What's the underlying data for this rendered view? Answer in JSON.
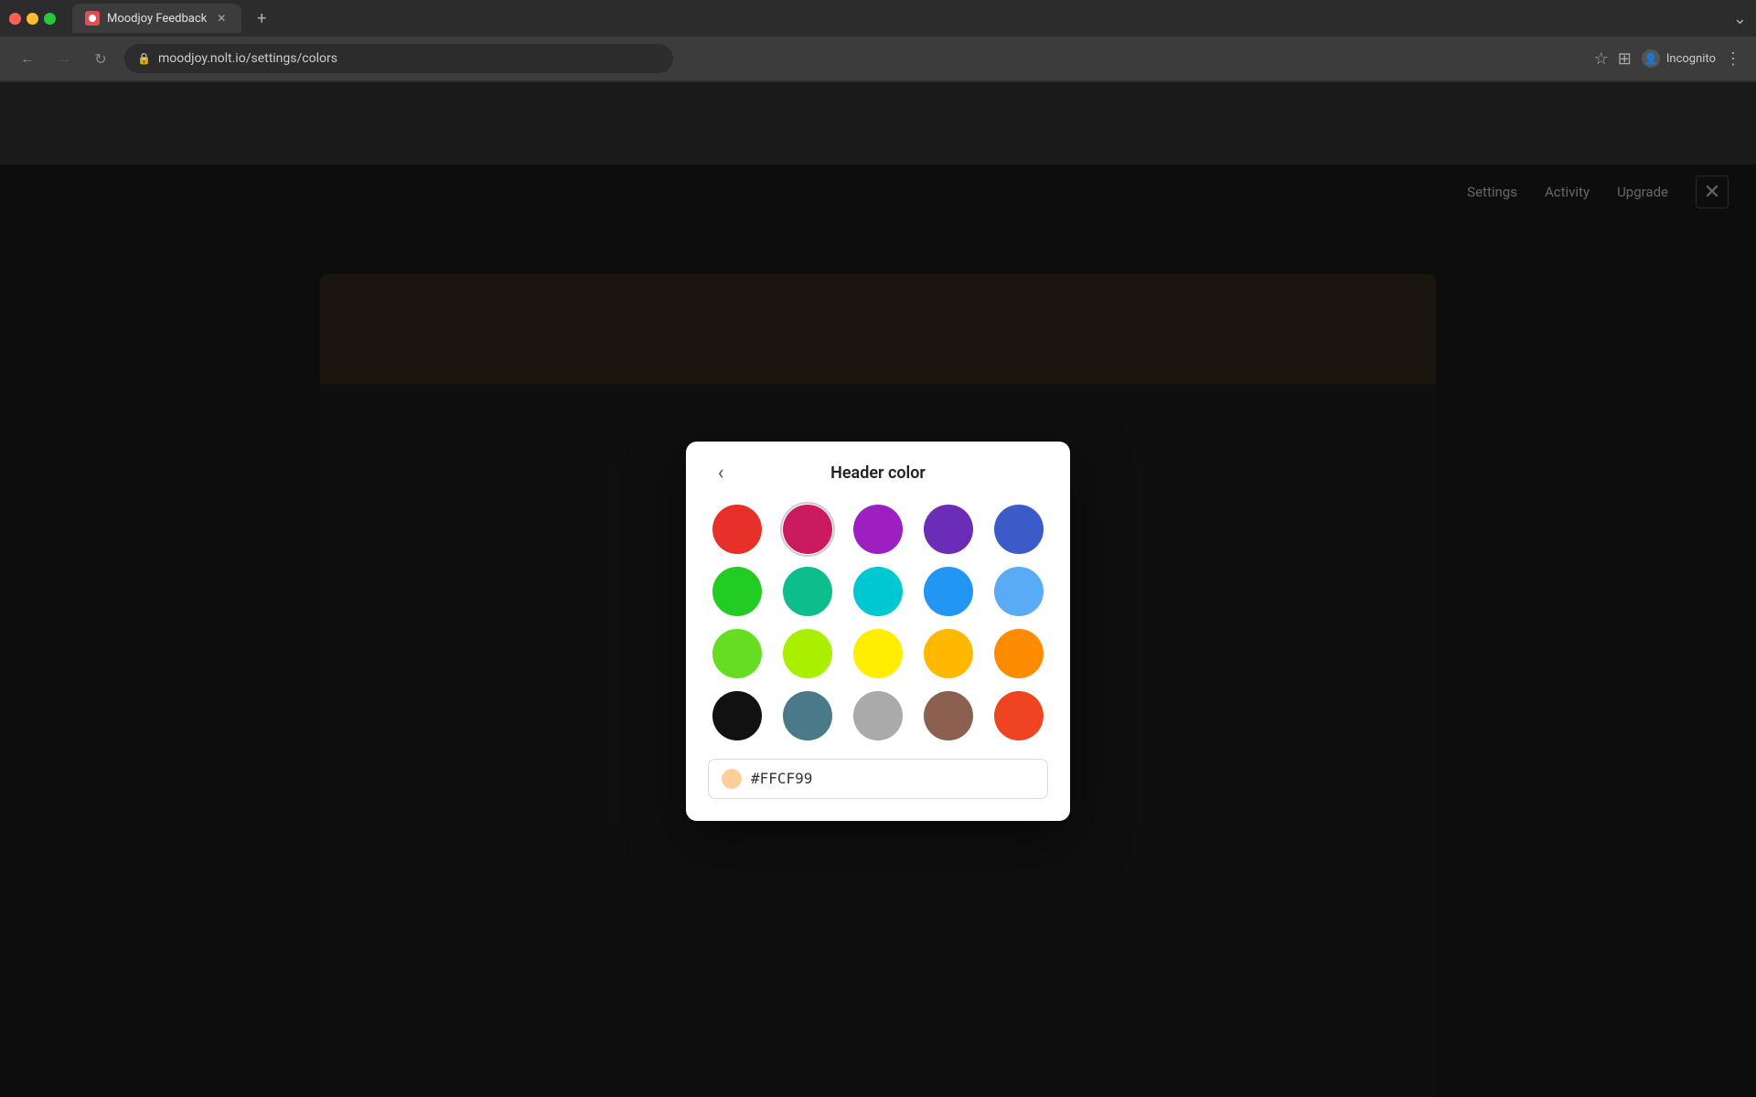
{
  "browser": {
    "tab_title": "Moodjoy Feedback",
    "url": "moodjoy.nolt.io/settings/colors",
    "incognito_label": "Incognito"
  },
  "top_nav": {
    "settings_label": "Settings",
    "activity_label": "Activity",
    "upgrade_label": "Upgrade"
  },
  "modal": {
    "title": "Header color",
    "back_arrow": "‹",
    "hex_value": "#FFCF99",
    "hex_color": "#FFCF99"
  },
  "colors": {
    "rows": [
      [
        {
          "hex": "#E8302A",
          "name": "red"
        },
        {
          "hex": "#CC1A5E",
          "name": "crimson"
        },
        {
          "hex": "#9B1FC1",
          "name": "purple"
        },
        {
          "hex": "#6B2DB5",
          "name": "violet"
        },
        {
          "hex": "#3B5BC8",
          "name": "blue"
        }
      ],
      [
        {
          "hex": "#22CC22",
          "name": "green"
        },
        {
          "hex": "#0DBD8B",
          "name": "teal"
        },
        {
          "hex": "#00C8D0",
          "name": "cyan"
        },
        {
          "hex": "#2196F3",
          "name": "cornflower-blue"
        },
        {
          "hex": "#5AABF5",
          "name": "light-blue"
        }
      ],
      [
        {
          "hex": "#66DD22",
          "name": "lime-green"
        },
        {
          "hex": "#AAEE00",
          "name": "chartreuse"
        },
        {
          "hex": "#FFEE00",
          "name": "yellow"
        },
        {
          "hex": "#FFB800",
          "name": "amber"
        },
        {
          "hex": "#FF8C00",
          "name": "orange"
        }
      ],
      [
        {
          "hex": "#111111",
          "name": "black"
        },
        {
          "hex": "#4A7A8A",
          "name": "slate"
        },
        {
          "hex": "#AAAAAA",
          "name": "gray"
        },
        {
          "hex": "#8B6050",
          "name": "brown"
        },
        {
          "hex": "#EE4422",
          "name": "red-orange"
        }
      ]
    ]
  },
  "icons": {
    "back": "‹",
    "close": "✕",
    "lock": "🔒",
    "star": "☆",
    "grid": "⊞",
    "settings": "⚙"
  }
}
